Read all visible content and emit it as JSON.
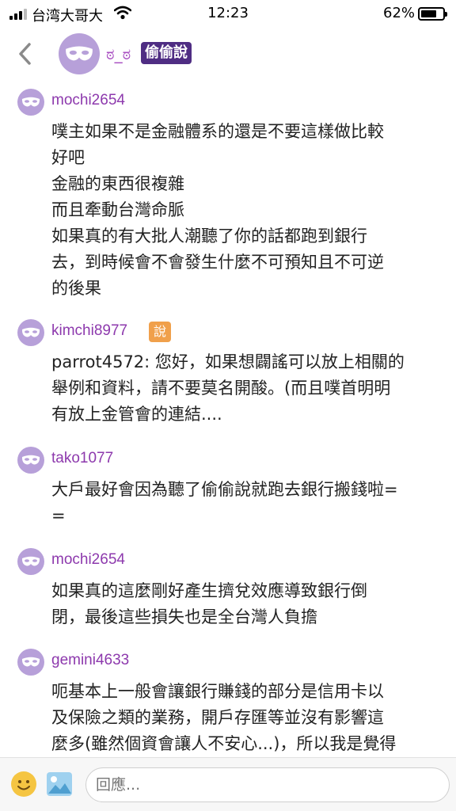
{
  "status_bar": {
    "carrier": "台湾大哥大",
    "time": "12:23",
    "battery_percent": "62%",
    "battery_level": 0.62,
    "icons": [
      "signal-icon",
      "wifi-icon",
      "battery-icon"
    ]
  },
  "header": {
    "name": "ಠ_ಠ",
    "badge": "偷偷說",
    "icons": [
      "back-chevron-icon",
      "mask-avatar-icon"
    ]
  },
  "comments": [
    {
      "user": "mochi2654",
      "badge": "",
      "lines": [
        "噗主如果不是金融體系的還是不要這樣做比較",
        "好吧",
        "金融的東西很複雜",
        "而且牽動台灣命脈",
        "如果真的有大批人潮聽了你的話都跑到銀行",
        "去，到時候會不會發生什麼不可預知且不可逆",
        "的後果"
      ]
    },
    {
      "user": "kimchi8977",
      "badge": "說",
      "lines": [
        "parrot4572: 您好，如果想闢謠可以放上相關的",
        "舉例和資料，請不要莫名開酸。(而且噗首明明",
        "有放上金管會的連結...."
      ]
    },
    {
      "user": "tako1077",
      "badge": "",
      "lines": [
        "大戶最好會因為聽了偷偷說就跑去銀行搬錢啦=",
        "="
      ]
    },
    {
      "user": "mochi2654",
      "badge": "",
      "lines": [
        "如果真的這麼剛好產生擠兌效應導致銀行倒",
        "閉，最後這些損失也是全台灣人負擔"
      ]
    },
    {
      "user": "gemini4633",
      "badge": "",
      "lines": [
        "呃基本上一般會讓銀行賺錢的部分是信用卡以",
        "及保險之類的業務，開戶存匯等並沒有影響這",
        "麼多(雖然個資會讓人不安心...)，所以我是覺得"
      ]
    }
  ],
  "bottom_bar": {
    "reply_placeholder": "回應...",
    "icons": [
      "emoji-icon",
      "photo-icon"
    ]
  },
  "colors": {
    "username": "#8d39ad",
    "header_badge": "#4f2d83",
    "avatar": "#b7a0d9",
    "speak_badge": "#f0a04b"
  }
}
